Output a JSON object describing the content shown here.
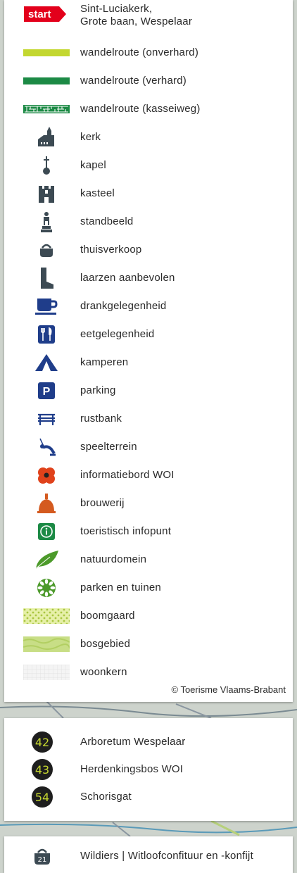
{
  "legend": {
    "start": {
      "badge": "start",
      "line1": "Sint-Luciakerk,",
      "line2": "Grote baan, Wespelaar"
    },
    "items": [
      {
        "icon": "route-unpaved",
        "label": "wandelroute (onverhard)"
      },
      {
        "icon": "route-paved",
        "label": "wandelroute (verhard)"
      },
      {
        "icon": "route-cobbled",
        "label": "wandelroute (kasseiweg)"
      },
      {
        "icon": "church-icon",
        "label": "kerk"
      },
      {
        "icon": "chapel-icon",
        "label": "kapel"
      },
      {
        "icon": "castle-icon",
        "label": "kasteel"
      },
      {
        "icon": "statue-icon",
        "label": "standbeeld"
      },
      {
        "icon": "basket-icon",
        "label": "thuisverkoop"
      },
      {
        "icon": "boot-icon",
        "label": "laarzen aanbevolen"
      },
      {
        "icon": "cup-icon",
        "label": "drankgelegenheid"
      },
      {
        "icon": "cutlery-icon",
        "label": "eetgelegenheid"
      },
      {
        "icon": "tent-icon",
        "label": "kamperen"
      },
      {
        "icon": "parking-icon",
        "label": "parking"
      },
      {
        "icon": "bench-icon",
        "label": "rustbank"
      },
      {
        "icon": "playground-icon",
        "label": "speelterrein"
      },
      {
        "icon": "poppy-icon",
        "label": "informatiebord WOI"
      },
      {
        "icon": "brewery-icon",
        "label": "brouwerij"
      },
      {
        "icon": "info-icon",
        "label": "toeristisch infopunt"
      },
      {
        "icon": "leaf-icon",
        "label": "natuurdomein"
      },
      {
        "icon": "flower-icon",
        "label": "parken en tuinen"
      },
      {
        "icon": "orchard-swatch",
        "label": "boomgaard"
      },
      {
        "icon": "forest-swatch",
        "label": "bosgebied"
      },
      {
        "icon": "residential-swatch",
        "label": "woonkern"
      }
    ],
    "credit": "© Toerisme Vlaams-Brabant"
  },
  "pois": [
    {
      "number": "42",
      "label": "Arboretum Wespelaar"
    },
    {
      "number": "43",
      "label": "Herdenkingsbos WOI"
    },
    {
      "number": "54",
      "label": "Schorisgat"
    }
  ],
  "producer": {
    "number": "21",
    "label": "Wildiers | Witloofconfituur en -konfijt"
  },
  "colors": {
    "unpaved": "#c3d730",
    "paved": "#1c8a45",
    "icon_dark": "#3c4a53",
    "icon_blue": "#1f3d8a",
    "poppy": "#e0421b",
    "brewery": "#d45a1f",
    "info": "#1c8a45",
    "leaf": "#4c9a2a",
    "start": "#e3001b",
    "badge_text": "#c5d630"
  }
}
